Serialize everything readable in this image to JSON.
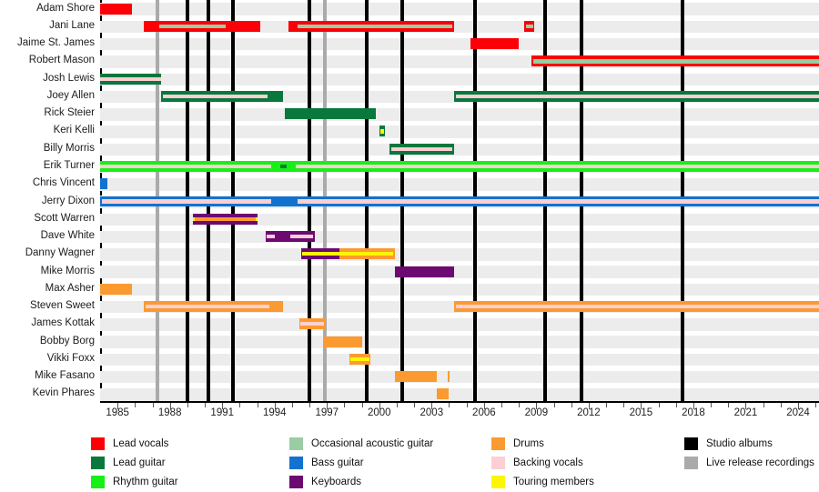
{
  "chart_data": {
    "type": "timeline",
    "title": "",
    "xlabel": "",
    "ylabel": "",
    "xlim": [
      1984.0,
      2025.2
    ],
    "grid": false,
    "legend_position": "bottom",
    "x_ticks": [
      "1985",
      "1988",
      "1991",
      "1994",
      "1997",
      "2000",
      "2003",
      "2006",
      "2009",
      "2012",
      "2015",
      "2018",
      "2021",
      "2024"
    ],
    "x_tick_values": [
      1985,
      1988,
      1991,
      1994,
      1997,
      2000,
      2003,
      2006,
      2009,
      2012,
      2015,
      2018,
      2021,
      2024
    ],
    "minor_tick_values": [
      1986,
      1987,
      1989,
      1990,
      1992,
      1993,
      1995,
      1996,
      1998,
      1999,
      2001,
      2002,
      2004,
      2005,
      2007,
      2008,
      2010,
      2011,
      2013,
      2014,
      2016,
      2017,
      2019,
      2020,
      2022,
      2023,
      2025
    ],
    "categories": [
      "Adam Shore",
      "Jani Lane",
      "Jaime St. James",
      "Robert Mason",
      "Josh Lewis",
      "Joey Allen",
      "Rick Steier",
      "Keri Kelli",
      "Billy Morris",
      "Erik Turner",
      "Chris Vincent",
      "Jerry Dixon",
      "Scott Warren",
      "Dave White",
      "Danny Wagner",
      "Mike Morris",
      "Max Asher",
      "Steven Sweet",
      "James Kottak",
      "Bobby Borg",
      "Vikki Foxx",
      "Mike Fasano",
      "Kevin Phares"
    ],
    "event_lines": [
      {
        "kind": "live",
        "year": 1987.3
      },
      {
        "kind": "studio",
        "year": 1989.0
      },
      {
        "kind": "studio",
        "year": 1990.2
      },
      {
        "kind": "studio",
        "year": 1991.6
      },
      {
        "kind": "studio",
        "year": 1996.0
      },
      {
        "kind": "live",
        "year": 1996.9
      },
      {
        "kind": "studio",
        "year": 1999.3
      },
      {
        "kind": "studio",
        "year": 2001.3
      },
      {
        "kind": "studio",
        "year": 2005.5
      },
      {
        "kind": "studio",
        "year": 2009.5
      },
      {
        "kind": "studio",
        "year": 2011.6
      },
      {
        "kind": "studio",
        "year": 2017.4
      }
    ],
    "series": [
      {
        "name": "Adam Shore",
        "role": "Lead vocals",
        "bars": [
          {
            "start": 1984.0,
            "end": 1985.8,
            "color": "lead_vocals"
          }
        ],
        "sub": []
      },
      {
        "name": "Jani Lane",
        "role": "Lead vocals",
        "bars": [
          {
            "start": 1986.5,
            "end": 1993.2,
            "color": "lead_vocals"
          },
          {
            "start": 1994.8,
            "end": 2004.3,
            "color": "lead_vocals"
          },
          {
            "start": 2008.3,
            "end": 2008.9,
            "color": "lead_vocals"
          }
        ],
        "sub": [
          {
            "start": 1987.4,
            "end": 1991.2,
            "color": "occasional_acoustic"
          },
          {
            "start": 1995.3,
            "end": 2004.2,
            "color": "occasional_acoustic"
          },
          {
            "start": 2008.4,
            "end": 2008.8,
            "color": "occasional_acoustic"
          }
        ]
      },
      {
        "name": "Jaime St. James",
        "role": "Lead vocals",
        "bars": [
          {
            "start": 2005.2,
            "end": 2008.0,
            "color": "lead_vocals"
          }
        ],
        "sub": []
      },
      {
        "name": "Robert Mason",
        "role": "Lead vocals",
        "bars": [
          {
            "start": 2008.7,
            "end": 2025.2,
            "color": "lead_vocals"
          }
        ],
        "sub": [
          {
            "start": 2008.8,
            "end": 2025.2,
            "color": "occasional_acoustic"
          }
        ]
      },
      {
        "name": "Josh Lewis",
        "role": "Lead guitar",
        "bars": [
          {
            "start": 1984.0,
            "end": 1987.5,
            "color": "lead_guitar"
          }
        ],
        "sub": [
          {
            "start": 1984.0,
            "end": 1987.5,
            "color": "backing_vocals"
          }
        ]
      },
      {
        "name": "Joey Allen",
        "role": "Lead guitar",
        "bars": [
          {
            "start": 1987.5,
            "end": 1994.5,
            "color": "lead_guitar"
          },
          {
            "start": 2004.3,
            "end": 2025.2,
            "color": "lead_guitar"
          }
        ],
        "sub": [
          {
            "start": 1987.6,
            "end": 1993.6,
            "color": "backing_vocals"
          },
          {
            "start": 2004.4,
            "end": 2025.2,
            "color": "backing_vocals"
          }
        ]
      },
      {
        "name": "Rick Steier",
        "role": "Lead guitar",
        "bars": [
          {
            "start": 1994.6,
            "end": 1999.8,
            "color": "lead_guitar"
          }
        ],
        "sub": []
      },
      {
        "name": "Keri Kelli",
        "role": "Lead guitar",
        "bars": [
          {
            "start": 2000.0,
            "end": 2000.3,
            "color": "lead_guitar"
          }
        ],
        "sub": [
          {
            "start": 2000.05,
            "end": 2000.28,
            "color": "touring"
          }
        ]
      },
      {
        "name": "Billy Morris",
        "role": "Lead guitar",
        "bars": [
          {
            "start": 2000.6,
            "end": 2004.3,
            "color": "lead_guitar"
          }
        ],
        "sub": [
          {
            "start": 2000.7,
            "end": 2004.2,
            "color": "backing_vocals"
          }
        ]
      },
      {
        "name": "Erik Turner",
        "role": "Rhythm guitar",
        "bars": [
          {
            "start": 1984.0,
            "end": 2025.2,
            "color": "rhythm_guitar"
          }
        ],
        "sub": [
          {
            "start": 1984.0,
            "end": 1993.8,
            "color": "backing_vocals"
          },
          {
            "start": 1995.2,
            "end": 2025.2,
            "color": "backing_vocals"
          },
          {
            "start": 1994.3,
            "end": 1994.7,
            "color": "lead_guitar"
          }
        ]
      },
      {
        "name": "Chris Vincent",
        "role": "Bass guitar",
        "bars": [
          {
            "start": 1984.0,
            "end": 1984.4,
            "color": "bass_guitar"
          }
        ],
        "sub": []
      },
      {
        "name": "Jerry Dixon",
        "role": "Bass guitar",
        "bars": [
          {
            "start": 1984.0,
            "end": 2025.2,
            "color": "bass_guitar"
          }
        ],
        "sub": [
          {
            "start": 1984.1,
            "end": 1993.8,
            "color": "backing_vocals"
          },
          {
            "start": 1995.3,
            "end": 2025.2,
            "color": "backing_vocals"
          }
        ]
      },
      {
        "name": "Scott Warren",
        "role": "Keyboards",
        "bars": [
          {
            "start": 1989.3,
            "end": 1993.0,
            "color": "keyboards"
          }
        ],
        "sub": [
          {
            "start": 1989.3,
            "end": 1993.0,
            "color": "touring"
          },
          {
            "start": 1989.4,
            "end": 1992.9,
            "color": "drums"
          }
        ]
      },
      {
        "name": "Dave White",
        "role": "Keyboards",
        "bars": [
          {
            "start": 1993.5,
            "end": 1996.3,
            "color": "keyboards"
          }
        ],
        "sub": [
          {
            "start": 1993.55,
            "end": 1994.0,
            "color": "backing_vocals"
          },
          {
            "start": 1994.9,
            "end": 1996.2,
            "color": "backing_vocals"
          }
        ]
      },
      {
        "name": "Danny Wagner",
        "role": "Keyboards",
        "bars": [
          {
            "start": 1995.5,
            "end": 1999.1,
            "color": "keyboards"
          },
          {
            "start": 1997.7,
            "end": 2000.9,
            "color": "drums"
          }
        ],
        "sub": [
          {
            "start": 1995.6,
            "end": 2000.8,
            "color": "touring"
          }
        ]
      },
      {
        "name": "Mike Morris",
        "role": "Keyboards",
        "bars": [
          {
            "start": 2000.9,
            "end": 2004.3,
            "color": "keyboards"
          }
        ],
        "sub": []
      },
      {
        "name": "Max Asher",
        "role": "Drums",
        "bars": [
          {
            "start": 1984.0,
            "end": 1985.8,
            "color": "drums"
          }
        ],
        "sub": []
      },
      {
        "name": "Steven Sweet",
        "role": "Drums",
        "bars": [
          {
            "start": 1986.5,
            "end": 1994.5,
            "color": "drums"
          },
          {
            "start": 2004.3,
            "end": 2025.2,
            "color": "drums"
          }
        ],
        "sub": [
          {
            "start": 1986.6,
            "end": 1993.7,
            "color": "backing_vocals"
          },
          {
            "start": 2004.4,
            "end": 2025.2,
            "color": "backing_vocals"
          }
        ]
      },
      {
        "name": "James Kottak",
        "role": "Drums",
        "bars": [
          {
            "start": 1995.4,
            "end": 1996.9,
            "color": "drums"
          }
        ],
        "sub": [
          {
            "start": 1995.45,
            "end": 1996.85,
            "color": "backing_vocals"
          }
        ]
      },
      {
        "name": "Bobby Borg",
        "role": "Drums",
        "bars": [
          {
            "start": 1996.8,
            "end": 1999.0,
            "color": "drums"
          }
        ],
        "sub": []
      },
      {
        "name": "Vikki Foxx",
        "role": "Drums",
        "bars": [
          {
            "start": 1998.3,
            "end": 1999.5,
            "color": "drums"
          }
        ],
        "sub": [
          {
            "start": 1998.35,
            "end": 1999.45,
            "color": "touring"
          }
        ]
      },
      {
        "name": "Mike Fasano",
        "role": "Drums",
        "bars": [
          {
            "start": 2000.9,
            "end": 2003.3,
            "color": "drums"
          },
          {
            "start": 2003.9,
            "end": 2004.0,
            "color": "drums"
          }
        ],
        "sub": []
      },
      {
        "name": "Kevin Phares",
        "role": "Drums",
        "bars": [
          {
            "start": 2003.3,
            "end": 2004.0,
            "color": "drums"
          }
        ],
        "sub": []
      }
    ]
  },
  "colors": {
    "lead_vocals": "#fb0007",
    "lead_guitar": "#08783d",
    "rhythm_guitar": "#17f017",
    "occasional_acoustic": "#9bcda4",
    "bass_guitar": "#1272cf",
    "keyboards": "#6d0a72",
    "drums": "#fb9a30",
    "backing_vocals": "#fbcfd4",
    "touring": "#fcf603",
    "studio_albums": "#000000",
    "live_release": "#aaaaaa",
    "band": "#ececec"
  },
  "legend": {
    "columns": [
      {
        "items": [
          {
            "label": "Lead vocals",
            "color_key": "lead_vocals"
          },
          {
            "label": "Lead guitar",
            "color_key": "lead_guitar"
          },
          {
            "label": "Rhythm guitar",
            "color_key": "rhythm_guitar"
          }
        ]
      },
      {
        "items": [
          {
            "label": "Occasional acoustic guitar",
            "color_key": "occasional_acoustic"
          },
          {
            "label": "Bass guitar",
            "color_key": "bass_guitar"
          },
          {
            "label": "Keyboards",
            "color_key": "keyboards"
          }
        ]
      },
      {
        "items": [
          {
            "label": "Drums",
            "color_key": "drums"
          },
          {
            "label": "Backing vocals",
            "color_key": "backing_vocals"
          },
          {
            "label": "Touring members",
            "color_key": "touring"
          }
        ]
      },
      {
        "items": [
          {
            "label": "Studio albums",
            "color_key": "studio_albums"
          },
          {
            "label": "Live release recordings",
            "color_key": "live_release"
          }
        ]
      }
    ]
  }
}
